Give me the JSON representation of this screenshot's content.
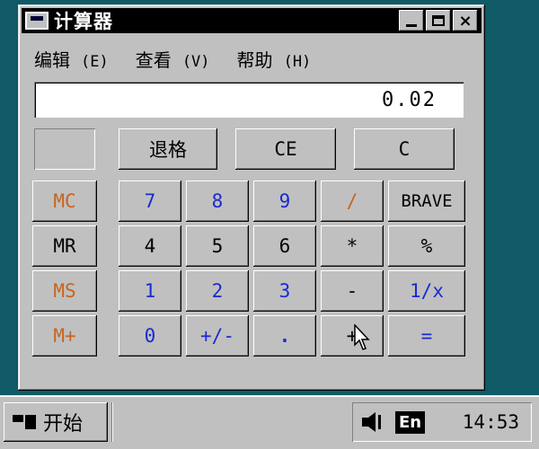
{
  "window": {
    "title": "计算器",
    "close_label": "×"
  },
  "menu": {
    "items": [
      {
        "label": "编辑",
        "key": "(E)"
      },
      {
        "label": "查看",
        "key": "(V)"
      },
      {
        "label": "帮助",
        "key": "(H)"
      }
    ]
  },
  "display": {
    "value": "0.02"
  },
  "buttons": {
    "backspace": "退格",
    "ce": "CE",
    "c": "C",
    "mc": "MC",
    "mr": "MR",
    "ms": "MS",
    "mplus": "M+",
    "n7": "7",
    "n8": "8",
    "n9": "9",
    "n4": "4",
    "n5": "5",
    "n6": "6",
    "n1": "1",
    "n2": "2",
    "n3": "3",
    "n0": "0",
    "sign": "+/-",
    "dot": ".",
    "div": "/",
    "mul": "*",
    "sub": "-",
    "add": "+",
    "eq": "=",
    "brave": "BRAVE",
    "percent": "%",
    "recip": "1/x"
  },
  "taskbar": {
    "start_label": "开始",
    "language": "En",
    "time": "14:53"
  },
  "colors": {
    "desktop": "#0f5a66",
    "face": "#c0c0c0",
    "digit_blue": "#1a2ad0",
    "memory_red": "#c8641e"
  }
}
